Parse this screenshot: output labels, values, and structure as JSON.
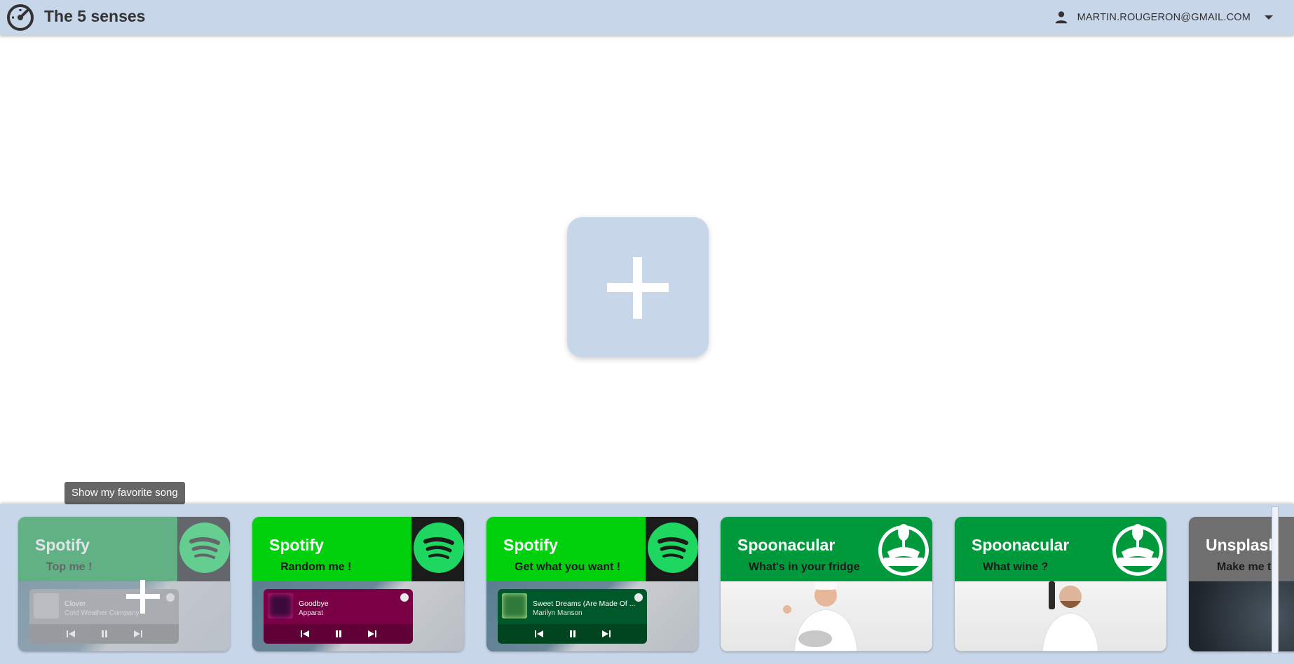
{
  "header": {
    "app_title": "The 5 senses",
    "user_email": "MARTIN.ROUGERON@GMAIL.COM"
  },
  "tooltip": {
    "text": "Show my favorite song"
  },
  "cards": [
    {
      "service": "Spotify",
      "subtitle": "Top me !",
      "track": "Clover",
      "artist": "Cold Weather Company",
      "head_color": "#1aa34a",
      "player_color": "#9a9a9a",
      "faded": true
    },
    {
      "service": "Spotify",
      "subtitle": "Random me !",
      "track": "Goodbye",
      "artist": "Apparat",
      "head_color": "#00d10c",
      "player_color": "#7a0046"
    },
    {
      "service": "Spotify",
      "subtitle": "Get what you want !",
      "track": "Sweet Dreams (Are Made Of ...",
      "artist": "Marilyn Manson",
      "head_color": "#00d10c",
      "player_color": "#00582a"
    },
    {
      "service": "Spoonacular",
      "subtitle": "What's in your fridge",
      "head_color": "#009a3c"
    },
    {
      "service": "Spoonacular",
      "subtitle": "What wine ?",
      "head_color": "#009a3c"
    },
    {
      "service": "Unsplash",
      "subtitle": "Make me tr",
      "head_color": "#6f6f6f"
    }
  ],
  "icons": {
    "logo": "speedometer-icon",
    "user": "person-icon",
    "dropdown": "caret-down-icon",
    "add": "plus-icon"
  },
  "colors": {
    "header_bg": "#c8d6ea",
    "spotify_green": "#1ed760",
    "spoonacular_green": "#009a3c"
  }
}
